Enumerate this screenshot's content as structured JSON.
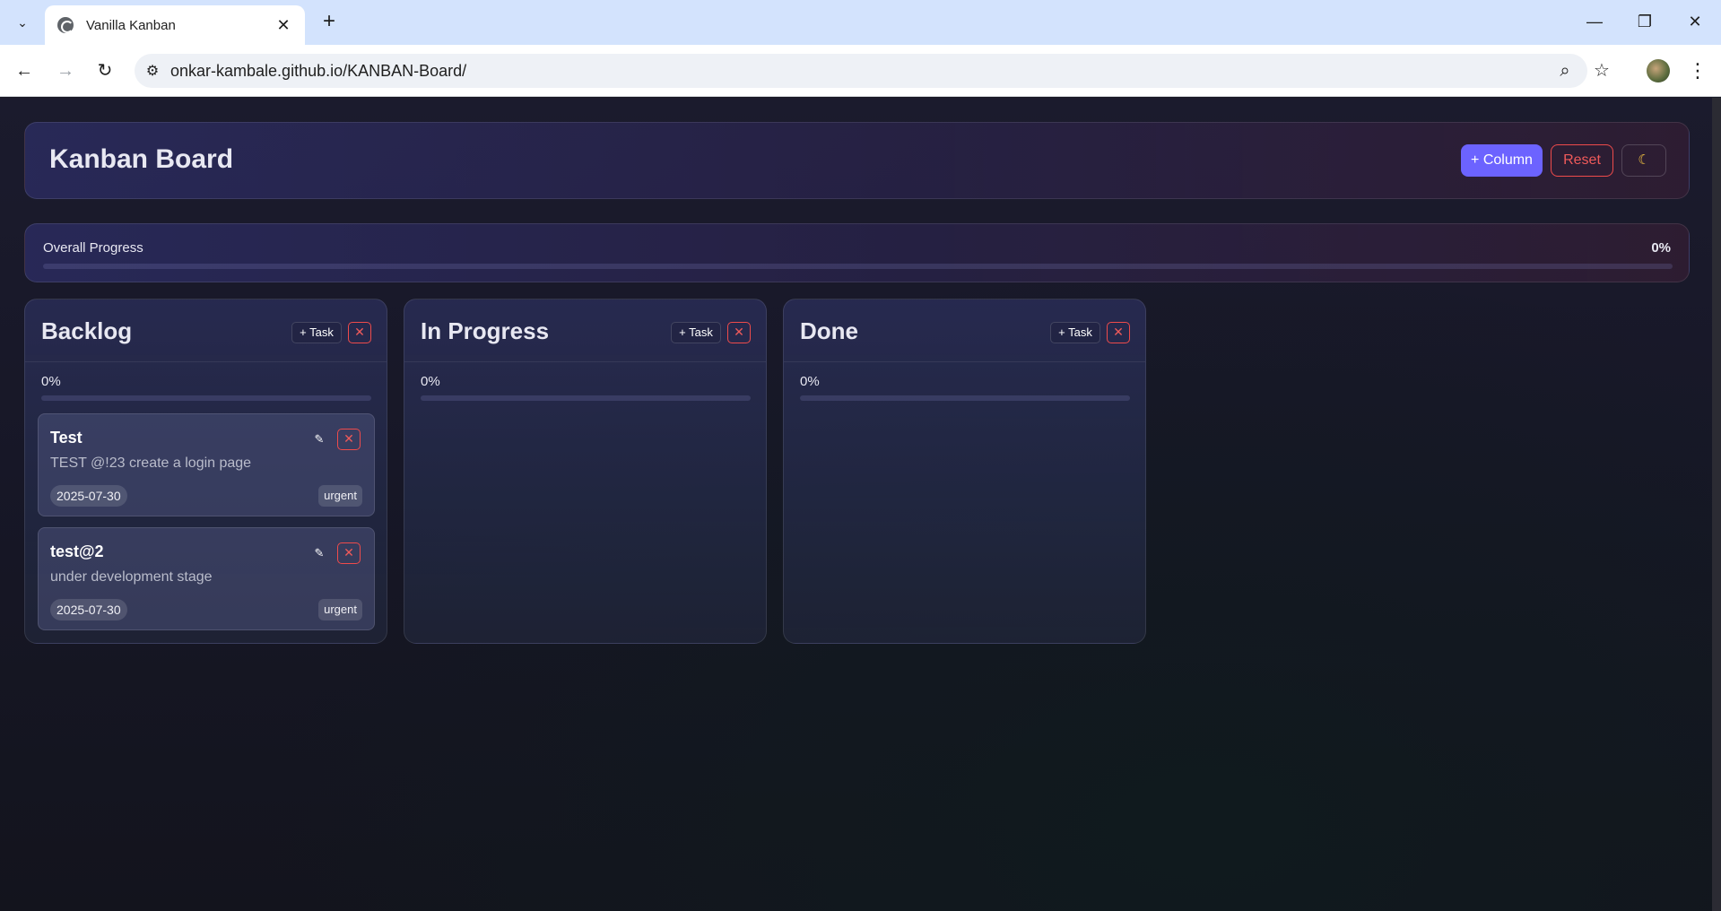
{
  "browser": {
    "tab_title": "Vanilla Kanban",
    "url": "onkar-kambale.github.io/KANBAN-Board/"
  },
  "header": {
    "title": "Kanban Board",
    "add_column_label": "+ Column",
    "reset_label": "Reset",
    "theme_icon": "☾"
  },
  "overall": {
    "label": "Overall Progress",
    "percent_text": "0%",
    "progress": 0
  },
  "columns": [
    {
      "title": "Backlog",
      "add_task_label": "+ Task",
      "percent_text": "0%",
      "progress": 0,
      "cards": [
        {
          "title": "Test",
          "description": "TEST @!23 create a login page",
          "date": "2025-07-30",
          "tag": "urgent"
        },
        {
          "title": "test@2",
          "description": "under development stage",
          "date": "2025-07-30",
          "tag": "urgent"
        }
      ]
    },
    {
      "title": "In Progress",
      "add_task_label": "+ Task",
      "percent_text": "0%",
      "progress": 0,
      "cards": []
    },
    {
      "title": "Done",
      "add_task_label": "+ Task",
      "percent_text": "0%",
      "progress": 0,
      "cards": []
    }
  ],
  "colors": {
    "accent": "#6c63ff",
    "danger": "#ef4b4b"
  }
}
